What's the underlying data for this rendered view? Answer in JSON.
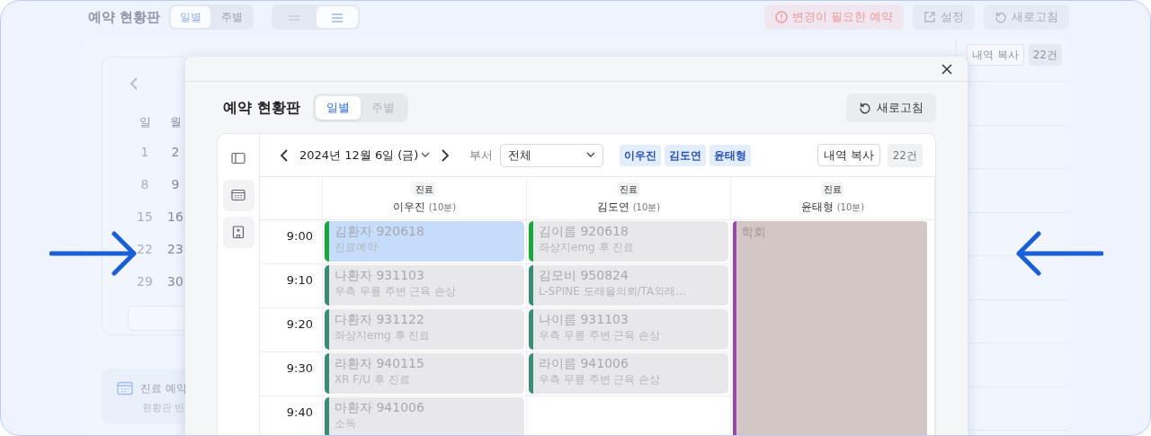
{
  "background": {
    "title": "예약 현황판",
    "view_tabs": [
      {
        "label": "일별",
        "selected": true
      },
      {
        "label": "주별",
        "selected": false
      }
    ],
    "layout_toggle": [
      {
        "kind": "lines",
        "selected": false
      },
      {
        "kind": "list",
        "selected": true
      }
    ],
    "actions": [
      {
        "kind": "warning",
        "label": "변경이 필요한 예약"
      },
      {
        "kind": "settings",
        "label": "설정"
      },
      {
        "kind": "refresh",
        "label": "새로고침"
      }
    ],
    "calendar": {
      "weekdays": [
        "일",
        "월"
      ],
      "weeks": [
        [
          "1",
          "2"
        ],
        [
          "8",
          "9"
        ],
        [
          "15",
          "16"
        ],
        [
          "22",
          "23"
        ],
        [
          "29",
          "30"
        ]
      ]
    },
    "notice": {
      "title": "진료 예약",
      "text": "현황판 빈"
    },
    "copy": "내역 복사",
    "count": "22건"
  },
  "modal": {
    "title": "예약 현황판",
    "view_tabs": [
      {
        "label": "일별",
        "selected": true
      },
      {
        "label": "주별",
        "selected": false
      }
    ],
    "refresh": "새로고침",
    "rail": [
      {
        "kind": "panel"
      },
      {
        "kind": "calendar"
      },
      {
        "kind": "building"
      }
    ],
    "date": "2024년 12월 6일 (금)",
    "department_label": "부서",
    "department": "전체",
    "staff_chips": [
      "이우진",
      "김도연",
      "윤태형"
    ],
    "copy": "내역 복사",
    "count": "22건",
    "times": [
      "9:00",
      "9:10",
      "9:20",
      "9:30",
      "9:40"
    ],
    "columns": [
      {
        "tag": "진료",
        "name": "이우진",
        "duration": "(10분)",
        "events": [
          {
            "kind": "appointment",
            "title": "김환자 920618",
            "note": "진료예약",
            "color": "#16a83a",
            "selected": true
          },
          {
            "kind": "appointment",
            "title": "나환자 931103",
            "note": "우측 무릎 주변 근육 손상",
            "color": "#368f74",
            "selected": false
          },
          {
            "kind": "appointment",
            "title": "다환자 931122",
            "note": "좌상지emg 후 진료",
            "color": "#368f74",
            "selected": false
          },
          {
            "kind": "appointment",
            "title": "라환자 940115",
            "note": "XR F/U 후 진료",
            "color": "#368f74",
            "selected": false
          },
          {
            "kind": "appointment",
            "title": "마환자 941006",
            "note": "소독",
            "color": "#368f74",
            "selected": false
          }
        ]
      },
      {
        "tag": "진료",
        "name": "김도연",
        "duration": "(10분)",
        "events": [
          {
            "kind": "appointment",
            "title": "김이름 920618",
            "note": "좌상지emg 후 진료",
            "color": "#16a83a",
            "selected": false
          },
          {
            "kind": "appointment",
            "title": "김모비 950824",
            "note": "L-SPINE 도래울의뢰/TA외래…",
            "color": "#368f74",
            "selected": false
          },
          {
            "kind": "appointment",
            "title": "나이름 931103",
            "note": "우측 무릎 주변 근육 손상",
            "color": "#368f74",
            "selected": false
          },
          {
            "kind": "appointment",
            "title": "라이름 941006",
            "note": "우측 무릎 주변 근육 손상",
            "color": "#368f74",
            "selected": false
          }
        ]
      },
      {
        "tag": "진료",
        "name": "윤태형",
        "duration": "(10분)",
        "events": [
          {
            "kind": "block",
            "title": "학회",
            "color": "#9a48b0"
          }
        ]
      }
    ]
  }
}
